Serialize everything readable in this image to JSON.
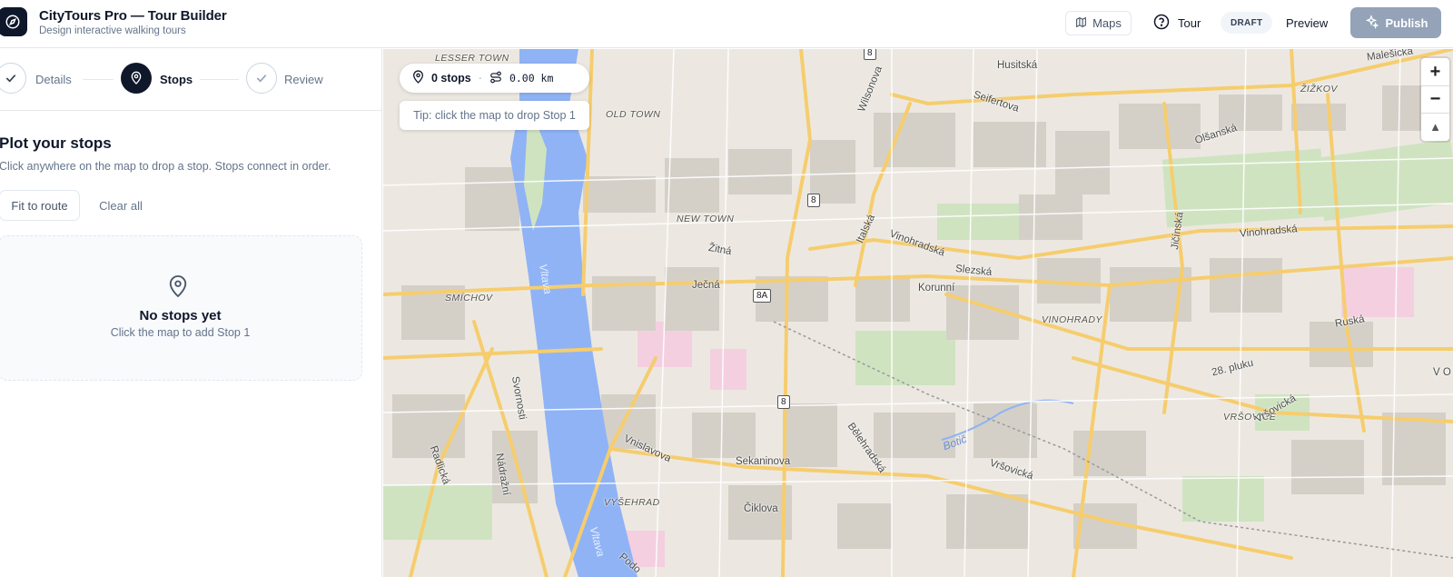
{
  "app": {
    "title": "CityTours Pro — Tour Builder",
    "subtitle": "Design interactive walking tours"
  },
  "header": {
    "maps_label": "Maps",
    "tour_label": "Tour",
    "status_badge": "DRAFT",
    "preview_label": "Preview",
    "publish_label": "Publish"
  },
  "steps": [
    {
      "label": "Details",
      "state": "done"
    },
    {
      "label": "Stops",
      "state": "active"
    },
    {
      "label": "Review",
      "state": "done"
    }
  ],
  "stops_panel": {
    "title": "Plot your stops",
    "description": "Click anywhere on the map to drop a stop. Stops connect in order.",
    "fit_label": "Fit to route",
    "clear_label": "Clear all",
    "empty_title": "No stops yet",
    "empty_sub": "Click the map to add Stop 1"
  },
  "map": {
    "stops_count": "0 stops",
    "distance": "0.00 km",
    "tip": "Tip: click the map to drop Stop 1",
    "zoom_in": "+",
    "zoom_out": "−",
    "compass": "▲",
    "labels": {
      "lesser_town": "LESSER TOWN",
      "old_town": "OLD TOWN",
      "new_town": "NEW TOWN",
      "smichov": "SMÍCHOV",
      "vinohrady": "VINOHRADY",
      "vrsovice": "VRŠOVICE",
      "vysehrad": "VYŠEHRAD",
      "zizkov": "ŽIŽKOV",
      "husitska": "Husitská",
      "seifertova": "Seifertova",
      "wilsonova": "Wilsonova",
      "olsanska": "Olšanská",
      "malesicka": "Malešická",
      "vinohradska": "Vinohradská",
      "vinohradska2": "Vinohradská",
      "italska": "Italská",
      "slezska": "Slezská",
      "korunni": "Korunní",
      "zitna": "Žitná",
      "jecna": "Ječná",
      "jiminska": "Jičínská",
      "ruska": "Ruská",
      "pluku": "28. pluku",
      "vrsovicka": "Vršovická",
      "vrsovicka2": "Vršovická",
      "belehradska": "Bělehradská",
      "botic": "Botič",
      "sekaninova": "Sekaninova",
      "ciklova": "Čiklova",
      "vnislavova": "Vnislavova",
      "svornosti": "Svornosti",
      "nadrazni": "Nádražní",
      "radlicka": "Radlická",
      "vltava": "Vltava",
      "vltava2": "Vltava",
      "podol": "Podo",
      "vo": "V O",
      "shield_8a": "8",
      "shield_8b": "8",
      "shield_8c": "8A",
      "shield_8d": "8"
    }
  }
}
